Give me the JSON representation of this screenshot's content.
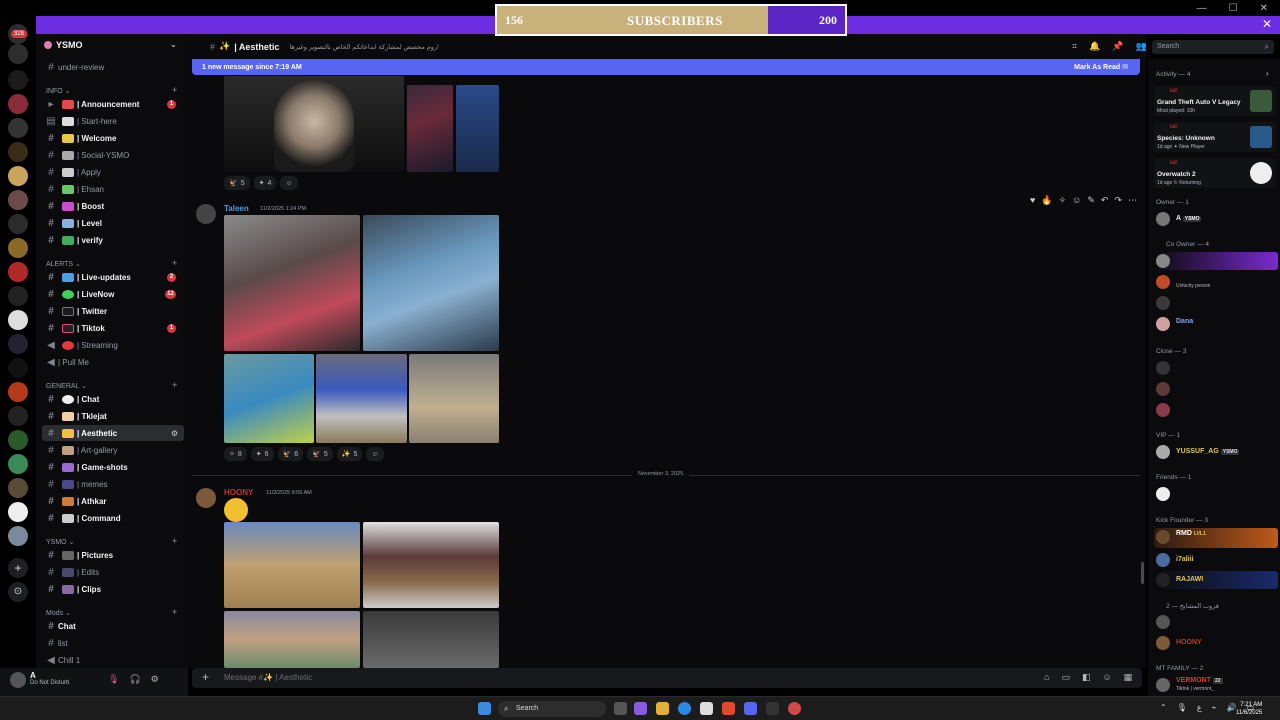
{
  "overlay": {
    "left_count": "156",
    "label": "SUBSCRIBERS",
    "right_count": "200"
  },
  "server": {
    "name": "YSMO",
    "under_review": "under-review"
  },
  "rail_badge": "328",
  "categories": {
    "info": "INFO",
    "alerts": "ALERTS",
    "general": "GENERAL",
    "ysmo": "YSMO",
    "mods": "Mods"
  },
  "channels": {
    "announcement": "| Announcement",
    "start_here": "| Start-here",
    "welcome": "| Welcome",
    "social": "| Social-YSMO",
    "apply": "| Apply",
    "ehsan": "| Ehsan",
    "boost": "| Boost",
    "level": "| Level",
    "verify": "| verify",
    "live_updates": "| Live-updates",
    "livenow": "| LiveNow",
    "twitter": "| Twitter",
    "tiktok": "| Tiktok",
    "streaming": "| Streaming",
    "pull_me": "| Pull Me",
    "chat": "| Chat",
    "tklejat": "| Tklejat",
    "aesthetic": "| Aesthetic",
    "art_gallery": "| Art-gallery",
    "game_shots": "| Game-shots",
    "memes": "| memes",
    "athkar": "| Athkar",
    "command": "| Command",
    "pictures": "| Pictures",
    "edits": "| Edits",
    "clips": "| Clips",
    "mods_chat": "Chat",
    "mods_list": "list",
    "mods_chill": "Chill 1"
  },
  "badges": {
    "announcement": "1",
    "live_updates": "2",
    "livenow": "12",
    "tiktok": "1"
  },
  "user": {
    "name": "A",
    "status": "Do Not Disturb"
  },
  "header": {
    "channel": "| Aesthetic",
    "topic": "روم مخصص لمشاركة ابداعاتكم الخاص بالتصوير وغيرها!",
    "search_placeholder": "Search"
  },
  "new_bar": {
    "text": "1 new message since 7:19 AM",
    "action": "Mark As Read"
  },
  "messages": [
    {
      "reactions": [
        "5",
        "4",
        ""
      ]
    },
    {
      "author": "Taleen",
      "time": "11/2/2025 1:24 PM",
      "reactions": [
        "8",
        "6",
        "6",
        "5",
        "5",
        ""
      ]
    },
    {
      "author": "HOONY",
      "time": "11/3/2025 9:55 AM"
    }
  ],
  "day_divider": "November 3, 2025",
  "composer": {
    "placeholder": "Message #✨ | Aesthetic"
  },
  "members": {
    "activity_title": "Activity — 4",
    "activities": [
      {
        "game": "Grand Theft Auto V Legacy",
        "sub": "Most played: 10h",
        "user": "ta8"
      },
      {
        "game": "Species: Unknown",
        "sub": "1d ago  ✦ New Player",
        "user": "ta8"
      },
      {
        "game": "Overwatch 2",
        "sub": "1d ago  ↻ Returning",
        "user": "ta8"
      }
    ],
    "owner_title": "Owner — 1",
    "owner_name": "A",
    "owner_tag": "YSMO",
    "coowner_title": "Co Owner — 4",
    "coowner_status": "Unlucky person",
    "dana": "Dana",
    "close_title": "Close — 3",
    "vip_title": "VIP — 1",
    "vip_name": "YUSSUF_AG",
    "vip_tag": "YSMO",
    "friends_title": "Friends — 1",
    "kick_title": "Kick Founder — 3",
    "kick1": "RMD",
    "kick1_tag": "LVL1",
    "kick2": "i7aliii",
    "kick3": "RAJAWI",
    "group_title": "قروب المشايخ — 2",
    "hoony": "HOONY",
    "mt_title": "MT FAMILY — 2",
    "vermont": "VERMONT",
    "vermont_tag": "22",
    "vermont_status": "Tiktok | vermont_"
  },
  "taskbar": {
    "search": "Search",
    "time": "7:21 AM",
    "date": "11/6/2025"
  }
}
